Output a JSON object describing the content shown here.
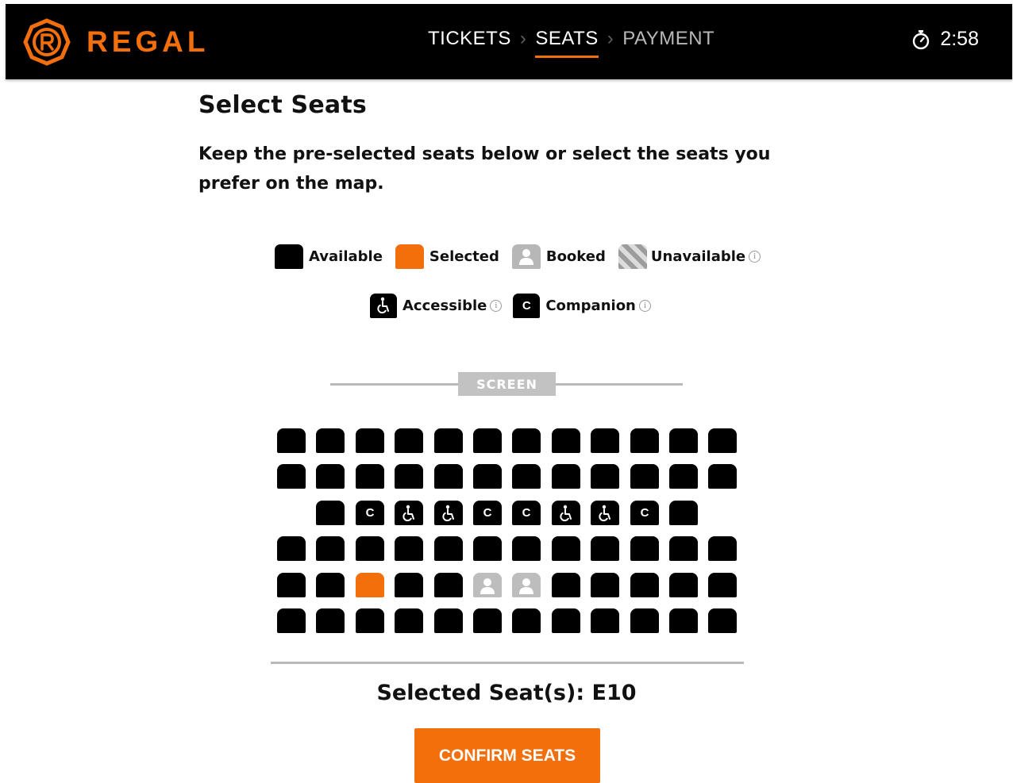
{
  "header": {
    "brand": "REGAL",
    "steps": [
      {
        "label": "TICKETS",
        "state": "done"
      },
      {
        "label": "SEATS",
        "state": "active"
      },
      {
        "label": "PAYMENT",
        "state": "upcoming"
      }
    ],
    "timer": "2:58"
  },
  "main": {
    "title": "Select Seats",
    "instructions": "Keep the pre-selected seats below or select the seats you prefer on the map."
  },
  "legend": {
    "available": "Available",
    "selected": "Selected",
    "booked": "Booked",
    "unavailable": "Unavailable",
    "accessible": "Accessible",
    "companion": "Companion",
    "companion_glyph": "C",
    "info_glyph": "i"
  },
  "screen_label": "SCREEN",
  "seat_map": {
    "rows": [
      [
        "A",
        "A",
        "A",
        "A",
        "A",
        "A",
        "A",
        "A",
        "A",
        "A",
        "A",
        "A"
      ],
      [
        "A",
        "A",
        "A",
        "A",
        "A",
        "A",
        "A",
        "A",
        "A",
        "A",
        "A",
        "A"
      ],
      [
        "-",
        "A",
        "C",
        "W",
        "W",
        "C",
        "C",
        "W",
        "W",
        "C",
        "A",
        "-"
      ],
      [
        "A",
        "A",
        "A",
        "A",
        "A",
        "A",
        "A",
        "A",
        "A",
        "A",
        "A",
        "A"
      ],
      [
        "A",
        "A",
        "S",
        "A",
        "A",
        "B",
        "B",
        "A",
        "A",
        "A",
        "A",
        "A"
      ],
      [
        "A",
        "A",
        "A",
        "A",
        "A",
        "A",
        "A",
        "A",
        "A",
        "A",
        "A",
        "A"
      ]
    ]
  },
  "selection": {
    "text": "Selected Seat(s): E10"
  },
  "confirm_label": "CONFIRM SEATS",
  "colors": {
    "accent": "#f26f0c",
    "header_bg": "#000000",
    "booked": "#bdbdbd"
  }
}
